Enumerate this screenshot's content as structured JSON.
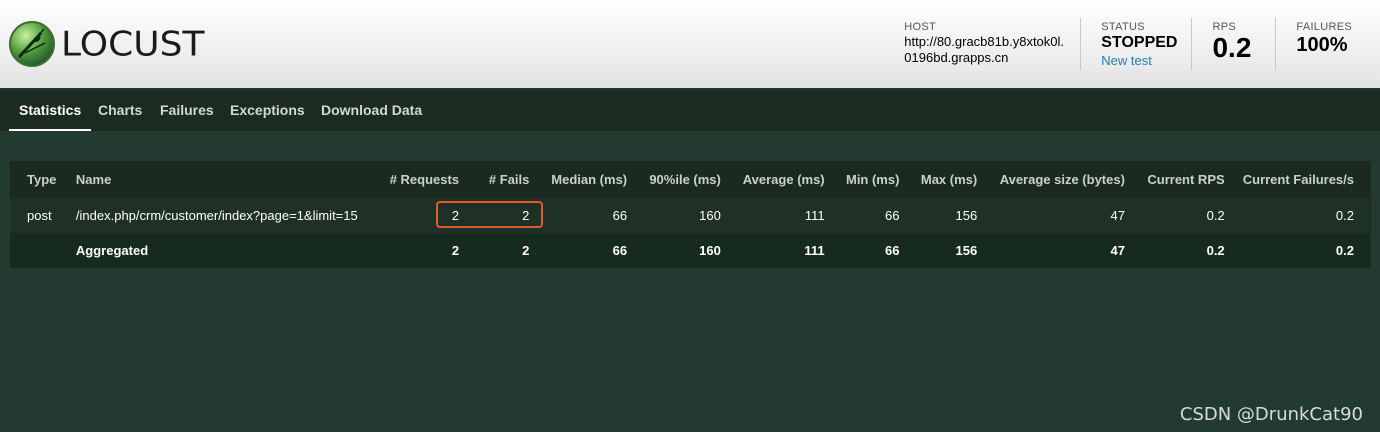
{
  "header": {
    "logo_text": "LOCUST",
    "host_label": "HOST",
    "host_value": "http://80.gracb81b.y8xtok0l.0196bd.grapps.cn",
    "status_label": "STATUS",
    "status_value": "STOPPED",
    "new_test_label": "New test",
    "rps_label": "RPS",
    "rps_value": "0.2",
    "failures_label": "FAILURES",
    "failures_value": "100%"
  },
  "tabs": [
    "Statistics",
    "Charts",
    "Failures",
    "Exceptions",
    "Download Data"
  ],
  "table": {
    "columns": [
      "Type",
      "Name",
      "# Requests",
      "# Fails",
      "Median (ms)",
      "90%ile (ms)",
      "Average (ms)",
      "Min (ms)",
      "Max (ms)",
      "Average size (bytes)",
      "Current RPS",
      "Current Failures/s"
    ],
    "rows": [
      [
        "post",
        "/index.php/crm/customer/index?page=1&limit=15",
        "2",
        "2",
        "66",
        "160",
        "111",
        "66",
        "156",
        "47",
        "0.2",
        "0.2"
      ]
    ],
    "aggregated": [
      "",
      "Aggregated",
      "2",
      "2",
      "66",
      "160",
      "111",
      "66",
      "156",
      "47",
      "0.2",
      "0.2"
    ]
  },
  "watermark": "CSDN @DrunkCat90",
  "colors": {
    "background": "#233a30",
    "tab_bar": "#1b2b22",
    "highlight_border": "#e25b2c",
    "link": "#2b7bb9"
  }
}
